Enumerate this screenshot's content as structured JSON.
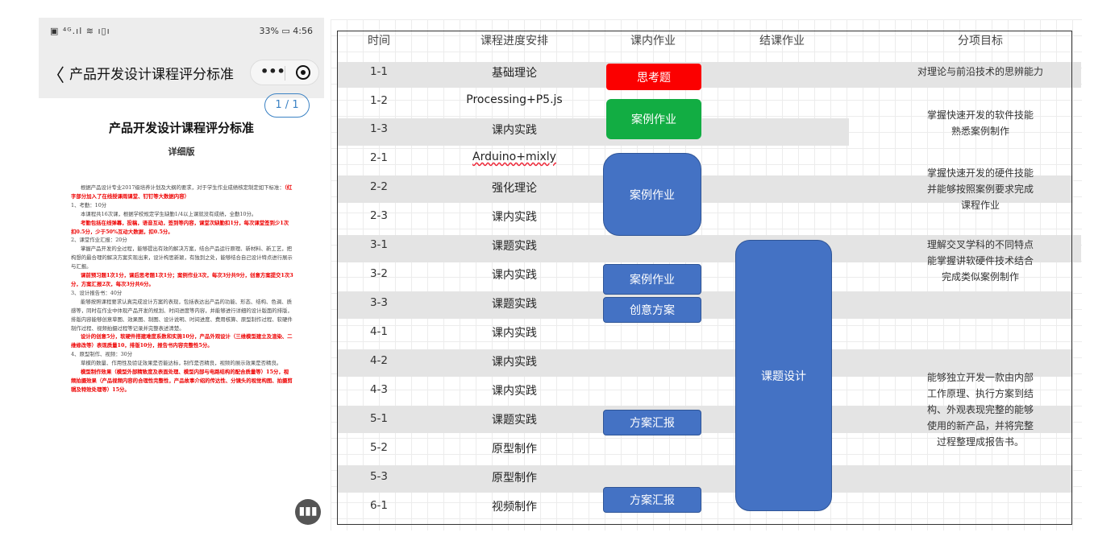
{
  "phone": {
    "status_left": "▣ ⁴ᴳ.ıl ≋ ı▯ı",
    "status_right": "33% ▭ 4:56",
    "nav_back": "〈",
    "nav_title": "产品开发设计课程评分标准",
    "nav_more": "•••",
    "page_badge": "1 / 1",
    "doc_title": "产品开发设计课程评分标准",
    "doc_subtitle": "详细版",
    "para1": "根据产品设计专业2017级培养计划及大纲的要求，对于学生作业成绩核定制定如下标准：",
    "para1_red": "（红字部分加入了在线授课雨课堂、钉钉等大数据内容）",
    "item1": "1、考勤：10分",
    "item1_text": "本课程共16次课，根据学校规定学生缺勤1/4以上课就没有成绩，全勤10分。",
    "item1_red": "考勤包括在线弹幕，投稿，语音互动，签到等内容，课堂次缺勤扣1分，每次课堂签到少1次扣0.5分，少于50%互动大数据，扣0.5分。",
    "item2": "2、课堂作业汇报：20分",
    "item2_text": "掌握产品开发的全过程，能够提出有效的解决方案，结合产品运行原理、新材料、新工艺，把构想的最合理的解决方案实现出来，设计构思新颖，有独到之处，能够结合自己设计特点进行展示与汇报。",
    "item2_red": "课前预习题1次1分，课后思考题1次1分；案例作业3次，每次3分共9分，创意方案提交1次3分，方案汇报2次，每次3分共6分。",
    "item3": "3、设计报告书：40分",
    "item3_text": "能够按照课程要求认真完成设计方案的表现，包括表达出产品的功能、形态、结构、色调、质感等，同时在作业中体现产品开发的规划、时间进度等内容，并能够进行详细的设计版面的排版，排版内容能够创意草图、效果图、制图、设计说明、时间进度、费用核算、原型制作过程、软硬件制作过程、视频拍摄过程等记录并完整表述清楚。",
    "item3_red": "设计的创意5分，软硬件搭建难度系数和实施10分，产品外观设计（三维模型建立及渲染、二维修改等）表现质量10，排版10分，报告书内容完整性5分。",
    "item4": "4、原型制作、视频：30分",
    "item4_text": "草模的数量、作用性及验证效果是否能达标，制作是否精良，视频的展示效果是否精良。",
    "item4_red": "模型制作效果（模型外部精致度及表面处理、模型内部与电路结构的配合质量等）15分，视频拍摄效果（产品视频内容的合理性完整性，产品故事介绍的传达性、分镜头的视觉构图、拍摄剪辑及特效处理等）15分。",
    "fab": "▮▮▮"
  },
  "schedule": {
    "headers": [
      "时间",
      "课程进度安排",
      "课内作业",
      "结课作业",
      "分项目标"
    ],
    "rows": [
      {
        "time": "1-1",
        "plan": "基础理论"
      },
      {
        "time": "1-2",
        "plan": "Processing+P5.js"
      },
      {
        "time": "1-3",
        "plan": "课内实践"
      },
      {
        "time": "2-1",
        "plan": "Arduino+mixly"
      },
      {
        "time": "2-2",
        "plan": "强化理论"
      },
      {
        "time": "2-3",
        "plan": "课内实践"
      },
      {
        "time": "3-1",
        "plan": "课题实践"
      },
      {
        "time": "3-2",
        "plan": "课内实践"
      },
      {
        "time": "3-3",
        "plan": "课题实践"
      },
      {
        "time": "4-1",
        "plan": "课内实践"
      },
      {
        "time": "4-2",
        "plan": "课内实践"
      },
      {
        "time": "4-3",
        "plan": "课内实践"
      },
      {
        "time": "5-1",
        "plan": "课题实践"
      },
      {
        "time": "5-2",
        "plan": "原型制作"
      },
      {
        "time": "5-3",
        "plan": "原型制作"
      },
      {
        "time": "6-1",
        "plan": "视频制作"
      }
    ],
    "blocks": {
      "thinking": "思考题",
      "case1": "案例作业",
      "case2": "案例作业",
      "case3": "案例作业",
      "creative": "创意方案",
      "report1": "方案汇报",
      "report2": "方案汇报",
      "final": "课题设计"
    },
    "goals": {
      "g1": "对理论与前沿技术的思辨能力",
      "g2a": "掌握快速开发的软件技能",
      "g2b": "熟悉案例制作",
      "g3a": "掌握快速开发的硬件技能",
      "g3b": "并能够按照案例要求完成",
      "g3c": "课程作业",
      "g4a": "理解交叉学科的不同特点",
      "g4b": "能掌握讲软硬件技术结合",
      "g4c": "完成类似案例制作",
      "g5a": "能够独立开发一款由内部",
      "g5b": "工作原理、执行方案到结",
      "g5c": "构、外观表现完整的能够",
      "g5d": "使用的新产品，并将完整",
      "g5e": "过程整理成报告书。"
    },
    "colors": {
      "red": "#fb0000",
      "green": "#12ad43",
      "blue": "#4472c4"
    }
  }
}
